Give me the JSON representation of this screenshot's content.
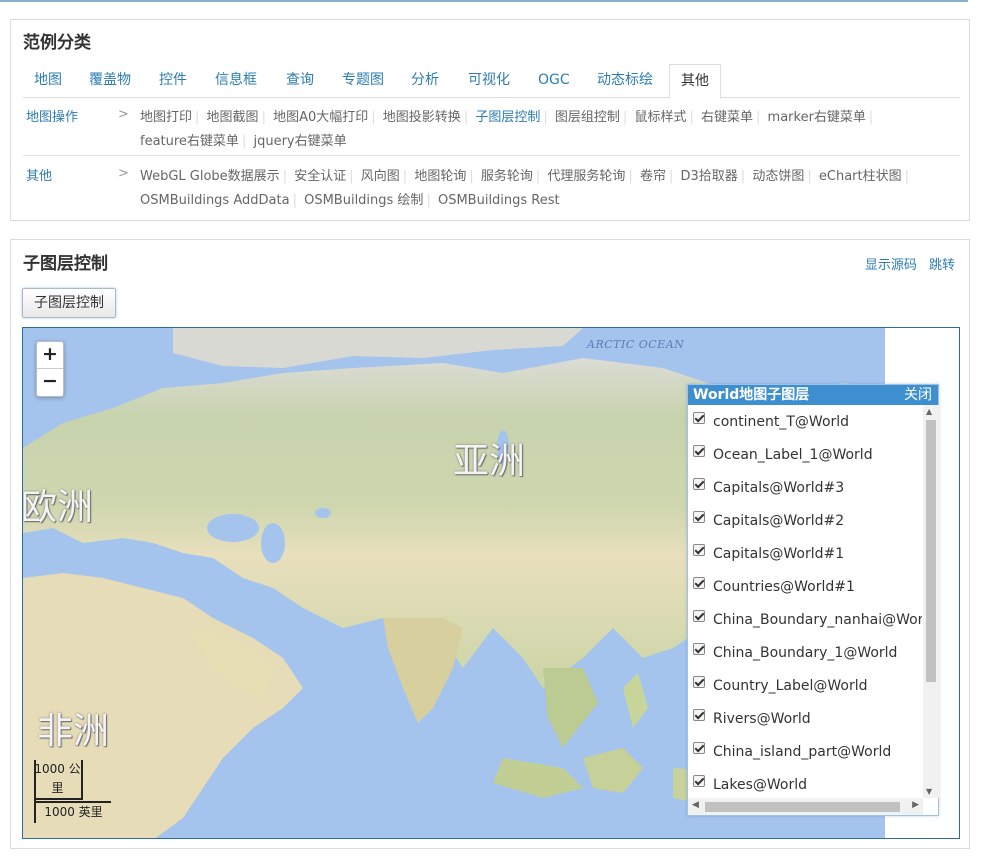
{
  "category_panel": {
    "title": "范例分类",
    "tabs": [
      "地图",
      "覆盖物",
      "控件",
      "信息框",
      "查询",
      "专题图",
      "分析",
      "可视化",
      "OGC",
      "动态标绘",
      "其他"
    ],
    "active_tab": "其他",
    "rows": [
      {
        "name": "地图操作",
        "arrow": ">",
        "links": [
          "地图打印",
          "地图截图",
          "地图A0大幅打印",
          "地图投影转换",
          "子图层控制",
          "图层组控制",
          "鼠标样式",
          "右键菜单",
          "marker右键菜单",
          "feature右键菜单",
          "jquery右键菜单"
        ]
      },
      {
        "name": "其他",
        "arrow": ">",
        "links": [
          "WebGL Globe数据展示",
          "安全认证",
          "风向图",
          "地图轮询",
          "服务轮询",
          "代理服务轮询",
          "卷帘",
          "D3拾取器",
          "动态饼图",
          "eChart柱状图",
          "OSMBuildings AddData",
          "OSMBuildings 绘制",
          "OSMBuildings Rest"
        ]
      }
    ],
    "active_link": "子图层控制"
  },
  "demo_panel": {
    "title": "子图层控制",
    "show_source": "显示源码",
    "jump": "跳转",
    "control_button": "子图层控制"
  },
  "map": {
    "zoom_in": "+",
    "zoom_out": "−",
    "labels": {
      "asia": "亚洲",
      "europe": "欧洲",
      "africa": "非洲",
      "arctic": "ARCTIC OCEAN"
    },
    "scale_km": "1000 公里",
    "scale_mi": "1000 英里"
  },
  "layer_window": {
    "title": "World地图子图层",
    "close": "关闭",
    "layers": [
      "continent_T@World",
      "Ocean_Label_1@World",
      "Capitals@World#3",
      "Capitals@World#2",
      "Capitals@World#1",
      "Countries@World#1",
      "China_Boundary_nanhai@World",
      "China_Boundary_1@World",
      "Country_Label@World",
      "Rivers@World",
      "China_island_part@World",
      "Lakes@World"
    ]
  },
  "colors": {
    "accent": "#2d7db3",
    "ocean": "#a4c4ee",
    "land": "#e9e2c4",
    "window_header": "#3e8fd0"
  }
}
